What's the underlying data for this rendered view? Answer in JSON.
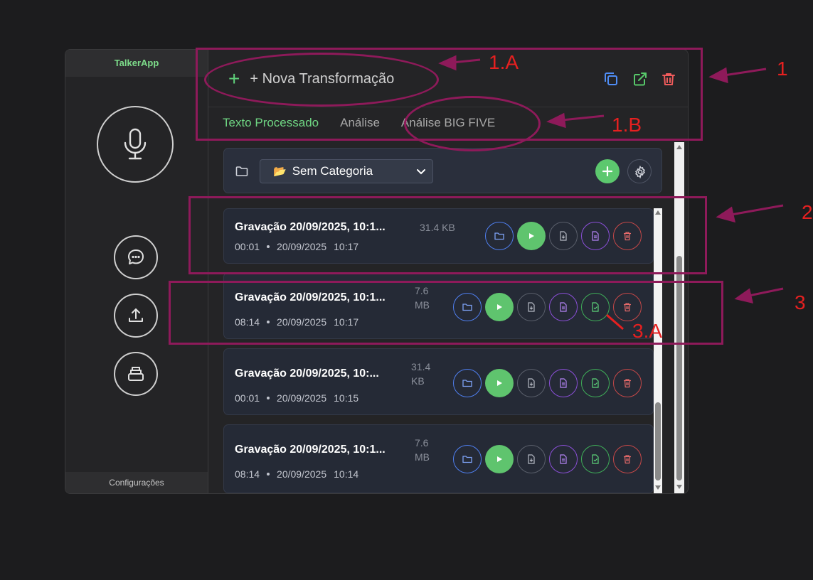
{
  "app": {
    "title": "TalkerApp",
    "settings_label": "Configurações"
  },
  "sidebar": {
    "icons": [
      "microphone-icon",
      "chat-icon",
      "upload-icon",
      "archive-icon"
    ]
  },
  "header": {
    "new_transform_label": "+ Nova Transformação",
    "plus_glyph": "+",
    "icons": [
      "copy-icon",
      "external-link-icon",
      "trash-icon"
    ],
    "icon_colors": {
      "copy": "#4f8df5",
      "external": "#57c96a",
      "trash": "#ef5b5b"
    }
  },
  "tabs": [
    {
      "label": "Texto Processado",
      "active": true
    },
    {
      "label": "Análise",
      "active": false
    },
    {
      "label": "Análise BIG FIVE",
      "active": false
    }
  ],
  "category": {
    "selected": "Sem Categoria",
    "folder_emoji": "📂"
  },
  "recordings": [
    {
      "title": "Gravação 20/09/2025, 10:1...",
      "size": "31.4 KB",
      "duration": "00:01",
      "date": "20/09/2025",
      "time": "10:17",
      "has_extra": false
    },
    {
      "title": "Gravação 20/09/2025, 10:1...",
      "size_line1": "7.6",
      "size_line2": "MB",
      "duration": "08:14",
      "date": "20/09/2025",
      "time": "10:17",
      "has_extra": true
    },
    {
      "title": "Gravação 20/09/2025, 10:...",
      "size_line1": "31.4",
      "size_line2": "KB",
      "duration": "00:01",
      "date": "20/09/2025",
      "time": "10:15",
      "has_extra": true
    },
    {
      "title": "Gravação 20/09/2025, 10:1...",
      "size_line1": "7.6",
      "size_line2": "MB",
      "duration": "08:14",
      "date": "20/09/2025",
      "time": "10:14",
      "has_extra": true
    }
  ],
  "action_colors": {
    "folder": "#4f7ff0",
    "play": "#5fc46e",
    "download": "#7a7f8a",
    "doc": "#a45df0",
    "doc_green": "#4cbf63",
    "delete": "#e05454"
  },
  "annotations": [
    "1",
    "1.A",
    "1.B",
    "2",
    "3",
    "3.A"
  ]
}
